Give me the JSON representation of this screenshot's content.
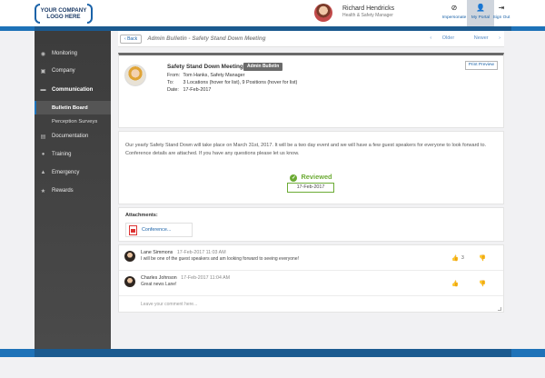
{
  "header": {
    "logo_line1": "YOUR COMPANY",
    "logo_line2": "LOGO HERE",
    "user_name": "Richard Hendricks",
    "user_role": "Health & Safety Manager",
    "actions": [
      {
        "label": "Impersonate",
        "icon": "eye-slash-icon"
      },
      {
        "label": "My Portal",
        "icon": "person-icon"
      },
      {
        "label": "Sign Out",
        "icon": "sign-out-icon"
      }
    ]
  },
  "sidebar": {
    "items": [
      {
        "label": "Monitoring",
        "icon": "eye-icon"
      },
      {
        "label": "Company",
        "icon": "building-icon"
      },
      {
        "label": "Communication",
        "icon": "chat-icon"
      },
      {
        "label": "Documentation",
        "icon": "book-icon"
      },
      {
        "label": "Training",
        "icon": "lightbulb-icon"
      },
      {
        "label": "Emergency",
        "icon": "alarm-icon"
      },
      {
        "label": "Rewards",
        "icon": "trophy-icon"
      }
    ],
    "sub_items": [
      {
        "label": "Bulletin Board",
        "active": true
      },
      {
        "label": "Perception Surveys",
        "active": false
      }
    ]
  },
  "breadcrumb": {
    "back_label": "Back",
    "title": "Admin Bulletin - Safety Stand Down Meeting",
    "older_label": "Older",
    "newer_label": "Newer"
  },
  "post": {
    "title": "Safety Stand Down Meeting",
    "badge": "Admin Bulletin",
    "from_label": "From:",
    "from_value": "Tom Hanks, Safety Manager",
    "to_label": "To:",
    "to_value": "3 Locations (hover for list), 9 Positions (hover for list)",
    "date_label": "Date:",
    "date_value": "17-Feb-2017",
    "print_label": "Print Preview",
    "body": "Our yearly Safety Stand Down will take place on March 31st, 2017. It will be a two day event and we will have a few guest speakers for everyone to look forward to. Conference details are attached. If you have any questions please let us know.",
    "reviewed_label": "Reviewed",
    "reviewed_date": "17-Feb-2017"
  },
  "attachments": {
    "title": "Attachments:",
    "items": [
      {
        "name": "Conference..."
      }
    ]
  },
  "comments": [
    {
      "author": "Lane Simmons",
      "time": "17-Feb-2017 11:03 AM",
      "text": "I will be one of the guest speakers and am looking forward to seeing everyone!",
      "likes": "3"
    },
    {
      "author": "Charles Johnson",
      "time": "17-Feb-2017 11:04 AM",
      "text": "Great news Lane!",
      "likes": ""
    }
  ],
  "comment_input": {
    "placeholder": "Leave your comment here..."
  },
  "colors": {
    "brand_blue": "#1e72b8",
    "reviewed_green": "#6cab35",
    "dislike_red": "#c62323"
  }
}
